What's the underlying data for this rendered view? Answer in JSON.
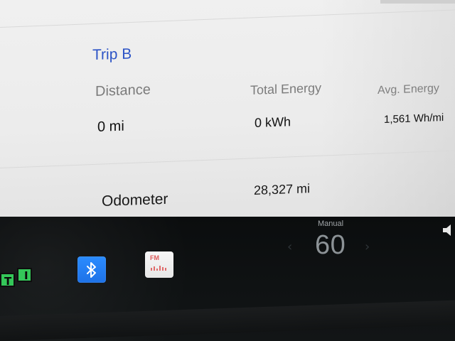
{
  "trip": {
    "title": "Trip B",
    "columns": {
      "distance_label": "Distance",
      "total_energy_label": "Total Energy",
      "avg_energy_label": "Avg. Energy"
    },
    "values": {
      "distance": "0 mi",
      "total_energy": "0 kWh",
      "avg_energy": "1,561 Wh/mi"
    },
    "odometer": {
      "label": "Odometer",
      "value": "28,327 mi"
    }
  },
  "dock": {
    "teams_icon": {
      "icon_name": "teams-app-icon",
      "left_letter": "T",
      "right_letter": "I"
    },
    "bluetooth_icon": {
      "icon_name": "bluetooth-icon"
    },
    "radio_icon": {
      "icon_name": "radio-icon",
      "label": "FM"
    },
    "speed_control": {
      "mode": "Manual",
      "value": "60"
    },
    "volume_icon": {
      "icon_name": "volume-icon"
    }
  },
  "colors": {
    "accent_blue": "#2c53c6",
    "bluetooth_blue": "#2b8cff",
    "teams_green": "#34c759",
    "radio_red": "#de5a5a"
  }
}
